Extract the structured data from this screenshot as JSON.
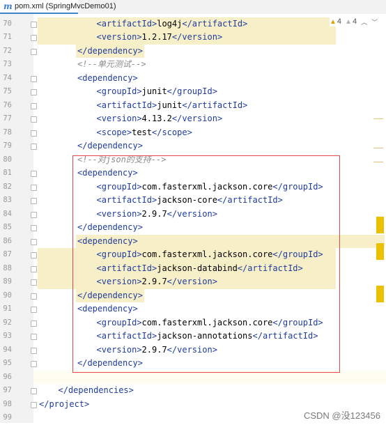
{
  "tab": {
    "title": "pom.xml (SpringMvcDemo01)"
  },
  "inspections": {
    "warnings": "4",
    "weak_warnings": "4"
  },
  "watermark": "CSDN @没123456",
  "lines": [
    {
      "n": "70",
      "indent": 3,
      "parts": [
        {
          "t": "<",
          "c": "tag"
        },
        {
          "t": "artifactId",
          "c": "tag"
        },
        {
          "t": ">",
          "c": "tag"
        },
        {
          "t": "log4j",
          "c": ""
        },
        {
          "t": "</",
          "c": "tag"
        },
        {
          "t": "artifactId",
          "c": "tag"
        },
        {
          "t": ">",
          "c": "tag"
        }
      ],
      "hl": "full"
    },
    {
      "n": "71",
      "indent": 3,
      "parts": [
        {
          "t": "<",
          "c": "tag"
        },
        {
          "t": "version",
          "c": "tag"
        },
        {
          "t": ">",
          "c": "tag"
        },
        {
          "t": "1.2.17",
          "c": ""
        },
        {
          "t": "</",
          "c": "tag"
        },
        {
          "t": "version",
          "c": "tag"
        },
        {
          "t": ">",
          "c": "tag"
        }
      ],
      "hl": "full"
    },
    {
      "n": "72",
      "indent": 2,
      "parts": [
        {
          "t": "</",
          "c": "tag"
        },
        {
          "t": "dependency",
          "c": "tag"
        },
        {
          "t": ">",
          "c": "tag"
        }
      ],
      "hl": "tag"
    },
    {
      "n": "73",
      "indent": 2,
      "parts": [
        {
          "t": "<!--单元测试-->",
          "c": "comment"
        }
      ],
      "hl": ""
    },
    {
      "n": "74",
      "indent": 2,
      "parts": [
        {
          "t": "<",
          "c": "tag"
        },
        {
          "t": "dependency",
          "c": "tag"
        },
        {
          "t": ">",
          "c": "tag"
        }
      ],
      "hl": ""
    },
    {
      "n": "75",
      "indent": 3,
      "parts": [
        {
          "t": "<",
          "c": "tag"
        },
        {
          "t": "groupId",
          "c": "tag"
        },
        {
          "t": ">",
          "c": "tag"
        },
        {
          "t": "junit",
          "c": ""
        },
        {
          "t": "</",
          "c": "tag"
        },
        {
          "t": "groupId",
          "c": "tag"
        },
        {
          "t": ">",
          "c": "tag"
        }
      ],
      "hl": ""
    },
    {
      "n": "76",
      "indent": 3,
      "parts": [
        {
          "t": "<",
          "c": "tag"
        },
        {
          "t": "artifactId",
          "c": "tag"
        },
        {
          "t": ">",
          "c": "tag"
        },
        {
          "t": "junit",
          "c": ""
        },
        {
          "t": "</",
          "c": "tag"
        },
        {
          "t": "artifactId",
          "c": "tag"
        },
        {
          "t": ">",
          "c": "tag"
        }
      ],
      "hl": ""
    },
    {
      "n": "77",
      "indent": 3,
      "parts": [
        {
          "t": "<",
          "c": "tag"
        },
        {
          "t": "version",
          "c": "tag"
        },
        {
          "t": ">",
          "c": "tag"
        },
        {
          "t": "4.13.2",
          "c": ""
        },
        {
          "t": "</",
          "c": "tag"
        },
        {
          "t": "version",
          "c": "tag"
        },
        {
          "t": ">",
          "c": "tag"
        }
      ],
      "hl": ""
    },
    {
      "n": "78",
      "indent": 3,
      "parts": [
        {
          "t": "<",
          "c": "tag"
        },
        {
          "t": "scope",
          "c": "tag"
        },
        {
          "t": ">",
          "c": "tag"
        },
        {
          "t": "test",
          "c": ""
        },
        {
          "t": "</",
          "c": "tag"
        },
        {
          "t": "scope",
          "c": "tag"
        },
        {
          "t": ">",
          "c": "tag"
        }
      ],
      "hl": ""
    },
    {
      "n": "79",
      "indent": 2,
      "parts": [
        {
          "t": "</",
          "c": "tag"
        },
        {
          "t": "dependency",
          "c": "tag"
        },
        {
          "t": ">",
          "c": "tag"
        }
      ],
      "hl": ""
    },
    {
      "n": "80",
      "indent": 2,
      "parts": [
        {
          "t": "<!--对json的支持-->",
          "c": "comment"
        }
      ],
      "hl": ""
    },
    {
      "n": "81",
      "indent": 2,
      "parts": [
        {
          "t": "<",
          "c": "tag"
        },
        {
          "t": "dependency",
          "c": "tag"
        },
        {
          "t": ">",
          "c": "tag"
        }
      ],
      "hl": ""
    },
    {
      "n": "82",
      "indent": 3,
      "parts": [
        {
          "t": "<",
          "c": "tag"
        },
        {
          "t": "groupId",
          "c": "tag"
        },
        {
          "t": ">",
          "c": "tag"
        },
        {
          "t": "com.fasterxml.jackson.core",
          "c": ""
        },
        {
          "t": "</",
          "c": "tag"
        },
        {
          "t": "groupId",
          "c": "tag"
        },
        {
          "t": ">",
          "c": "tag"
        }
      ],
      "hl": ""
    },
    {
      "n": "83",
      "indent": 3,
      "parts": [
        {
          "t": "<",
          "c": "tag"
        },
        {
          "t": "artifactId",
          "c": "tag"
        },
        {
          "t": ">",
          "c": "tag"
        },
        {
          "t": "jackson-core",
          "c": ""
        },
        {
          "t": "</",
          "c": "tag"
        },
        {
          "t": "artifactId",
          "c": "tag"
        },
        {
          "t": ">",
          "c": "tag"
        }
      ],
      "hl": ""
    },
    {
      "n": "84",
      "indent": 3,
      "parts": [
        {
          "t": "<",
          "c": "tag"
        },
        {
          "t": "version",
          "c": "tag"
        },
        {
          "t": ">",
          "c": "tag"
        },
        {
          "t": "2.9.7",
          "c": ""
        },
        {
          "t": "</",
          "c": "tag"
        },
        {
          "t": "version",
          "c": "tag"
        },
        {
          "t": ">",
          "c": "tag"
        }
      ],
      "hl": ""
    },
    {
      "n": "85",
      "indent": 2,
      "parts": [
        {
          "t": "</",
          "c": "tag"
        },
        {
          "t": "dependency",
          "c": "tag"
        },
        {
          "t": ">",
          "c": "tag"
        }
      ],
      "hl": ""
    },
    {
      "n": "86",
      "indent": 2,
      "parts": [
        {
          "t": "<",
          "c": "tag"
        },
        {
          "t": "dependency",
          "c": "tag"
        },
        {
          "t": ">",
          "c": "tag"
        }
      ],
      "hl": "wide"
    },
    {
      "n": "87",
      "indent": 3,
      "parts": [
        {
          "t": "<",
          "c": "tag"
        },
        {
          "t": "groupId",
          "c": "tag"
        },
        {
          "t": ">",
          "c": "tag"
        },
        {
          "t": "com.fasterxml.jackson.core",
          "c": ""
        },
        {
          "t": "</",
          "c": "tag"
        },
        {
          "t": "groupId",
          "c": "tag"
        },
        {
          "t": ">",
          "c": "tag"
        }
      ],
      "hl": "full"
    },
    {
      "n": "88",
      "indent": 3,
      "parts": [
        {
          "t": "<",
          "c": "tag"
        },
        {
          "t": "artifactId",
          "c": "tag"
        },
        {
          "t": ">",
          "c": "tag"
        },
        {
          "t": "jackson-databind",
          "c": ""
        },
        {
          "t": "</",
          "c": "tag"
        },
        {
          "t": "artifactId",
          "c": "tag"
        },
        {
          "t": ">",
          "c": "tag"
        }
      ],
      "hl": "full"
    },
    {
      "n": "89",
      "indent": 3,
      "parts": [
        {
          "t": "<",
          "c": "tag"
        },
        {
          "t": "version",
          "c": "tag"
        },
        {
          "t": ">",
          "c": "tag"
        },
        {
          "t": "2.9.7",
          "c": ""
        },
        {
          "t": "</",
          "c": "tag"
        },
        {
          "t": "version",
          "c": "tag"
        },
        {
          "t": ">",
          "c": "tag"
        }
      ],
      "hl": "full"
    },
    {
      "n": "90",
      "indent": 2,
      "parts": [
        {
          "t": "</",
          "c": "tag"
        },
        {
          "t": "dependency",
          "c": "tag"
        },
        {
          "t": ">",
          "c": "tag"
        }
      ],
      "hl": "tag"
    },
    {
      "n": "91",
      "indent": 2,
      "parts": [
        {
          "t": "<",
          "c": "tag"
        },
        {
          "t": "dependency",
          "c": "tag"
        },
        {
          "t": ">",
          "c": "tag"
        }
      ],
      "hl": ""
    },
    {
      "n": "92",
      "indent": 3,
      "parts": [
        {
          "t": "<",
          "c": "tag"
        },
        {
          "t": "groupId",
          "c": "tag"
        },
        {
          "t": ">",
          "c": "tag"
        },
        {
          "t": "com.fasterxml.jackson.core",
          "c": ""
        },
        {
          "t": "</",
          "c": "tag"
        },
        {
          "t": "groupId",
          "c": "tag"
        },
        {
          "t": ">",
          "c": "tag"
        }
      ],
      "hl": ""
    },
    {
      "n": "93",
      "indent": 3,
      "parts": [
        {
          "t": "<",
          "c": "tag"
        },
        {
          "t": "artifactId",
          "c": "tag"
        },
        {
          "t": ">",
          "c": "tag"
        },
        {
          "t": "jackson-annotations",
          "c": ""
        },
        {
          "t": "</",
          "c": "tag"
        },
        {
          "t": "artifactId",
          "c": "tag"
        },
        {
          "t": ">",
          "c": "tag"
        }
      ],
      "hl": ""
    },
    {
      "n": "94",
      "indent": 3,
      "parts": [
        {
          "t": "<",
          "c": "tag"
        },
        {
          "t": "version",
          "c": "tag"
        },
        {
          "t": ">",
          "c": "tag"
        },
        {
          "t": "2.9.7",
          "c": ""
        },
        {
          "t": "</",
          "c": "tag"
        },
        {
          "t": "version",
          "c": "tag"
        },
        {
          "t": ">",
          "c": "tag"
        }
      ],
      "hl": ""
    },
    {
      "n": "95",
      "indent": 2,
      "parts": [
        {
          "t": "</",
          "c": "tag"
        },
        {
          "t": "dependency",
          "c": "tag"
        },
        {
          "t": ">",
          "c": "tag"
        }
      ],
      "hl": ""
    },
    {
      "n": "96",
      "indent": 0,
      "parts": [],
      "hl": "caret"
    },
    {
      "n": "97",
      "indent": 1,
      "parts": [
        {
          "t": "</",
          "c": "tag"
        },
        {
          "t": "dependencies",
          "c": "tag"
        },
        {
          "t": ">",
          "c": "tag"
        }
      ],
      "hl": ""
    },
    {
      "n": "98",
      "indent": 0,
      "parts": [
        {
          "t": "</",
          "c": "tag"
        },
        {
          "t": "project",
          "c": "tag"
        },
        {
          "t": ">",
          "c": "tag"
        }
      ],
      "hl": ""
    },
    {
      "n": "99",
      "indent": 0,
      "parts": [],
      "hl": ""
    }
  ]
}
